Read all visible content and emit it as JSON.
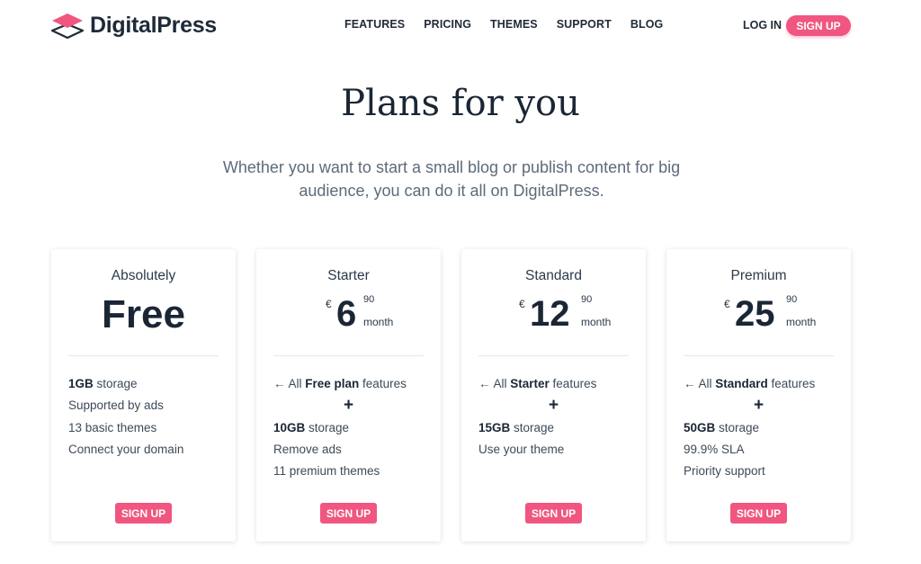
{
  "brand": {
    "name": "DigitalPress",
    "accent": "#f0567f"
  },
  "nav": {
    "items": [
      "FEATURES",
      "PRICING",
      "THEMES",
      "SUPPORT",
      "BLOG"
    ]
  },
  "auth": {
    "login": "LOG IN",
    "signup": "SIGN UP"
  },
  "hero": {
    "title": "Plans for you",
    "subtitle": "Whether you want to start a small blog or publish content for big audience, you can do it all on DigitalPress."
  },
  "plans": [
    {
      "name": "Absolutely",
      "price_text": "Free",
      "features": [
        {
          "bold": "1GB",
          "rest": " storage"
        },
        {
          "bold": "",
          "rest": "Supported by ads"
        },
        {
          "bold": "",
          "rest": "13 basic themes"
        },
        {
          "bold": "",
          "rest": "Connect your domain"
        }
      ],
      "button": "SIGN UP"
    },
    {
      "name": "Starter",
      "currency": "€",
      "amount": "6",
      "cents": "90",
      "period": "month",
      "inherit": {
        "prefix": "← All ",
        "bold": "Free plan",
        "suffix": " features"
      },
      "plus": "+",
      "features": [
        {
          "bold": "10GB",
          "rest": " storage"
        },
        {
          "bold": "",
          "rest": "Remove ads"
        },
        {
          "bold": "",
          "rest": "11 premium themes"
        }
      ],
      "button": "SIGN UP"
    },
    {
      "name": "Standard",
      "currency": "€",
      "amount": "12",
      "cents": "90",
      "period": "month",
      "inherit": {
        "prefix": "← All ",
        "bold": "Starter",
        "suffix": " features"
      },
      "plus": "+",
      "features": [
        {
          "bold": "15GB",
          "rest": " storage"
        },
        {
          "bold": "",
          "rest": "Use your theme"
        }
      ],
      "button": "SIGN UP"
    },
    {
      "name": "Premium",
      "currency": "€",
      "amount": "25",
      "cents": "90",
      "period": "month",
      "inherit": {
        "prefix": "← All ",
        "bold": "Standard",
        "suffix": " features"
      },
      "plus": "+",
      "features": [
        {
          "bold": "50GB",
          "rest": " storage"
        },
        {
          "bold": "",
          "rest": "99.9% SLA"
        },
        {
          "bold": "",
          "rest": "Priority support"
        }
      ],
      "button": "SIGN UP"
    }
  ]
}
